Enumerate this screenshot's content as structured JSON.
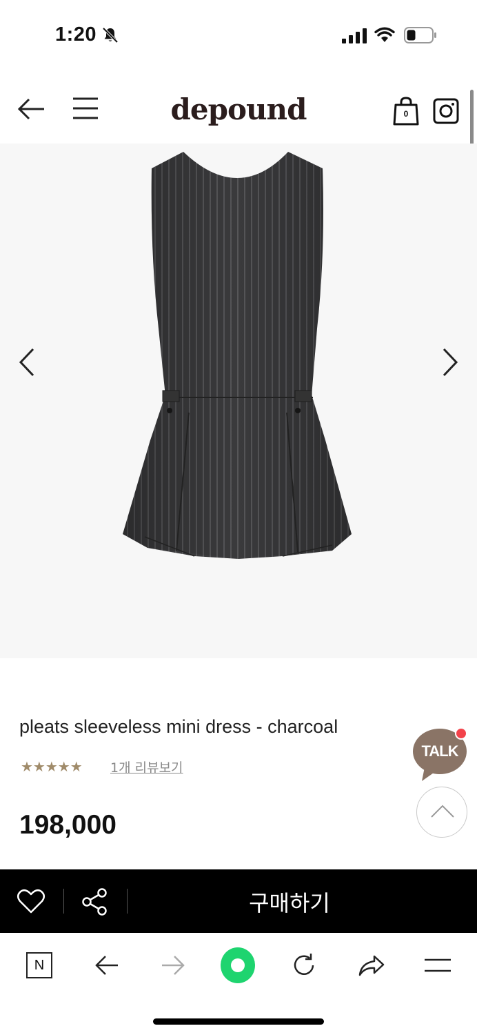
{
  "status_bar": {
    "time": "1:20"
  },
  "header": {
    "logo": "depound",
    "cart_count": "0"
  },
  "gallery": {
    "image": "charcoal pinstripe sleeveless pleated mini dress"
  },
  "product": {
    "name": "pleats sleeveless mini dress - charcoal",
    "rating_stars": 5,
    "stars": "★★★★★",
    "review_link": "1개 리뷰보기",
    "price": "198,000"
  },
  "floating": {
    "talk_label": "TALK"
  },
  "buy_bar": {
    "buy_label": "구매하기"
  },
  "browser_toolbar": {
    "n_label": "N",
    "accent_color": "#1ed46f"
  },
  "colors": {
    "logo": "#2b1d1d",
    "stars": "#a08b6a",
    "buy_bar": "#000000",
    "gallery_bg": "#f7f7f7",
    "talk_bubble": "#8a7466"
  }
}
